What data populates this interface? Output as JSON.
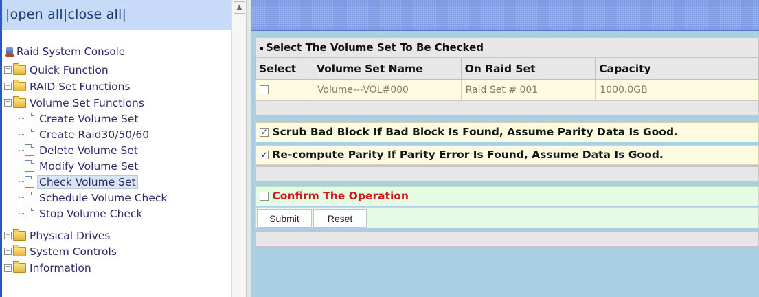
{
  "left_header": {
    "sep1": "|",
    "open_all": "open all",
    "sep2": "|",
    "close_all": "close all",
    "sep3": "|"
  },
  "tree": {
    "root": "Raid System Console",
    "items": [
      {
        "label": "Quick Function",
        "expanded": false
      },
      {
        "label": "RAID Set Functions",
        "expanded": false
      },
      {
        "label": "Volume Set Functions",
        "expanded": true,
        "children": [
          "Create Volume Set",
          "Create Raid30/50/60",
          "Delete Volume Set",
          "Modify Volume Set",
          "Check Volume Set",
          "Schedule Volume Check",
          "Stop Volume Check"
        ]
      },
      {
        "label": "Physical Drives",
        "expanded": false
      },
      {
        "label": "System Controls",
        "expanded": false
      },
      {
        "label": "Information",
        "expanded": false
      }
    ],
    "selected": "Check Volume Set",
    "expand_glyph": "+",
    "collapse_glyph": "−"
  },
  "main": {
    "section_title": "Select The Volume Set To Be Checked",
    "table": {
      "headers": [
        "Select",
        "Volume Set Name",
        "On Raid Set",
        "Capacity"
      ],
      "rows": [
        {
          "selected": false,
          "name": "Volume---VOL#000",
          "raid_set": "Raid Set # 001",
          "capacity": "1000.0GB"
        }
      ]
    },
    "options": [
      {
        "checked": true,
        "label": "Scrub Bad Block If Bad Block Is Found, Assume Parity Data Is Good."
      },
      {
        "checked": true,
        "label": "Re-compute Parity If Parity Error Is Found, Assume Data Is Good."
      }
    ],
    "confirm": {
      "checked": false,
      "label": "Confirm The Operation"
    },
    "buttons": {
      "submit": "Submit",
      "reset": "Reset"
    },
    "check_glyph": "✓"
  },
  "colors": {
    "accent_bar": "#2a58c8",
    "header_bg": "#c7daf7",
    "section_bg": "#e7e7e7",
    "row_bg": "#fffbe1",
    "confirm_bg": "#e4fbe4",
    "confirm_text": "#cc1b1b",
    "right_frame_bg": "#a8cfe3"
  }
}
